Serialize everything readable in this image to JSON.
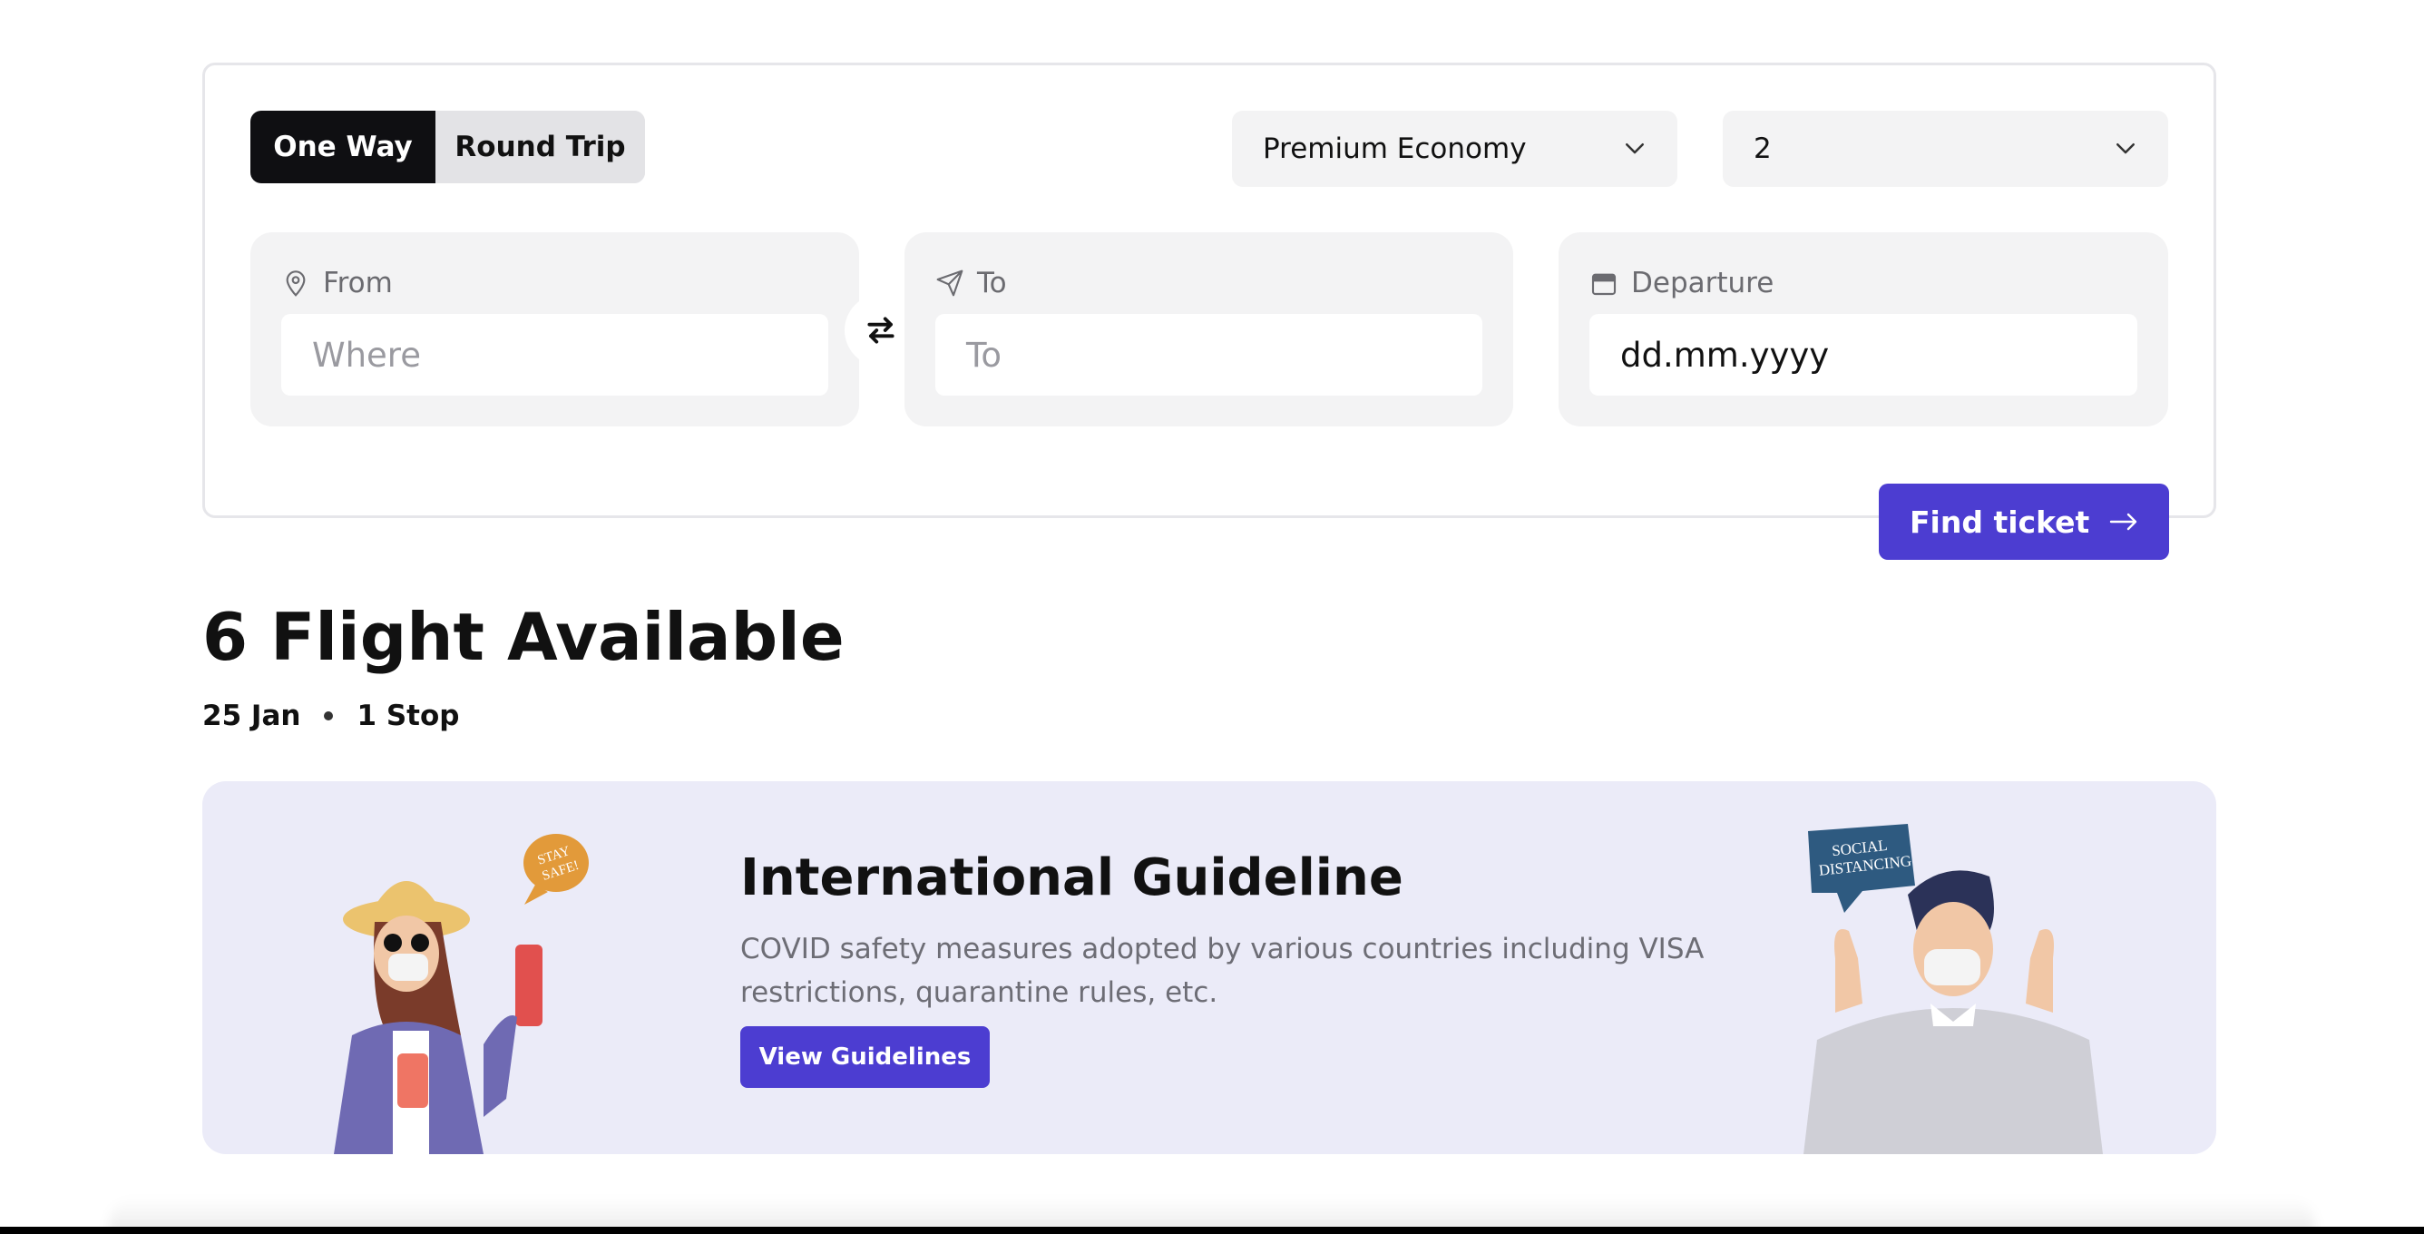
{
  "search": {
    "trip_types": [
      "One Way",
      "Round Trip"
    ],
    "active_trip_type": "One Way",
    "cabin_class": "Premium Economy",
    "passengers": "2",
    "from_label": "From",
    "from_placeholder": "Where",
    "to_label": "To",
    "to_placeholder": "To",
    "departure_label": "Departure",
    "departure_value": "dd.mm.yyyy",
    "find_button": "Find ticket"
  },
  "results": {
    "title": "6 Flight Available",
    "date": "25 Jan",
    "stops": "1 Stop"
  },
  "guideline": {
    "title": "International Guideline",
    "text": "COVID safety measures adopted by various countries including VISA restrictions, quarantine rules, etc.",
    "button": "View Guidelines",
    "bubble_left_line1": "STAY",
    "bubble_left_line2": "SAFE!",
    "bubble_right_line1": "SOCIAL",
    "bubble_right_line2": "DISTANCING"
  },
  "colors": {
    "accent": "#4c3dd1",
    "dark": "#0f0f12",
    "banner_bg": "#ebebf8"
  },
  "icons": [
    "chevron-down-icon",
    "location-pin-icon",
    "send-icon",
    "swap-icon",
    "calendar-icon",
    "arrow-right-icon"
  ]
}
